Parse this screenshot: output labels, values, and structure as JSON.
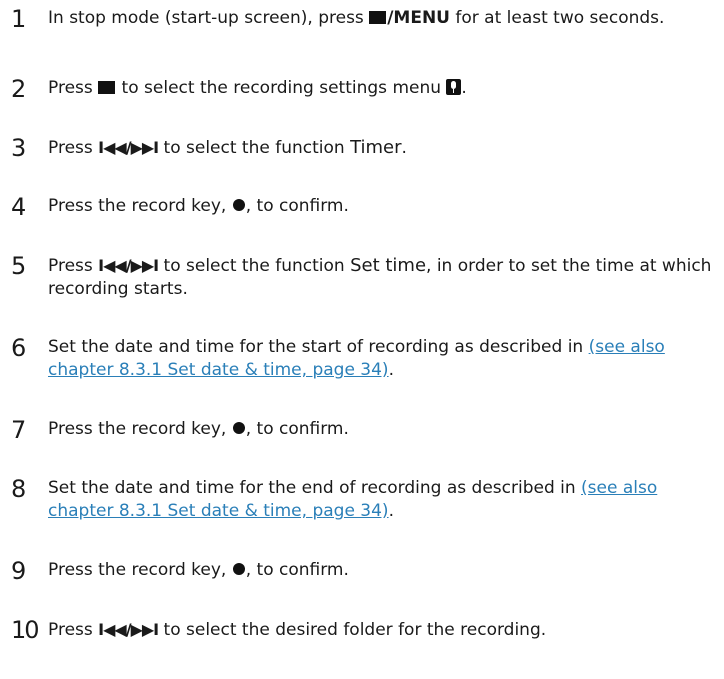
{
  "steps": [
    {
      "num": "1",
      "pre": "In stop mode (start-up screen), press ",
      "key": "/MENU",
      "post": " for at least two seconds."
    },
    {
      "num": "2",
      "pre": "Press ",
      "mid": " to select the recording settings menu ",
      "post": "."
    },
    {
      "num": "3",
      "pre": "Press ",
      "nav": "I◀◀/▶▶I",
      "mid": " to select the function ",
      "func": "Timer",
      "post": "."
    },
    {
      "num": "4",
      "pre": "Press the record key, ",
      "post": ", to confirm."
    },
    {
      "num": "5",
      "pre": "Press ",
      "nav": "I◀◀/▶▶I",
      "mid": " to select the function ",
      "func": "Set time",
      "post": ", in order to set the time at which recording starts."
    },
    {
      "num": "6",
      "pre": "Set the date and time for the start of recording as described in ",
      "link": "(see also chapter 8.3.1 Set date & time, page 34)",
      "post": "."
    },
    {
      "num": "7",
      "pre": "Press the record key, ",
      "post": ", to confirm."
    },
    {
      "num": "8",
      "pre": "Set the date and time for the end of recording as described in ",
      "link": "(see also chapter 8.3.1 Set date & time, page 34)",
      "post": "."
    },
    {
      "num": "9",
      "pre": "Press the record key, ",
      "post": ", to confirm."
    },
    {
      "num": "10",
      "pre": "Press ",
      "nav": "I◀◀/▶▶I",
      "post": " to select the desired folder for the recording."
    }
  ],
  "icons": {
    "folder": "folder-icon",
    "mic_menu": "microphone-settings-icon",
    "record": "record-dot-icon",
    "nav": "skip-back-forward-icon"
  },
  "colors": {
    "text": "#1a1a1a",
    "link": "#2a7fb8"
  }
}
